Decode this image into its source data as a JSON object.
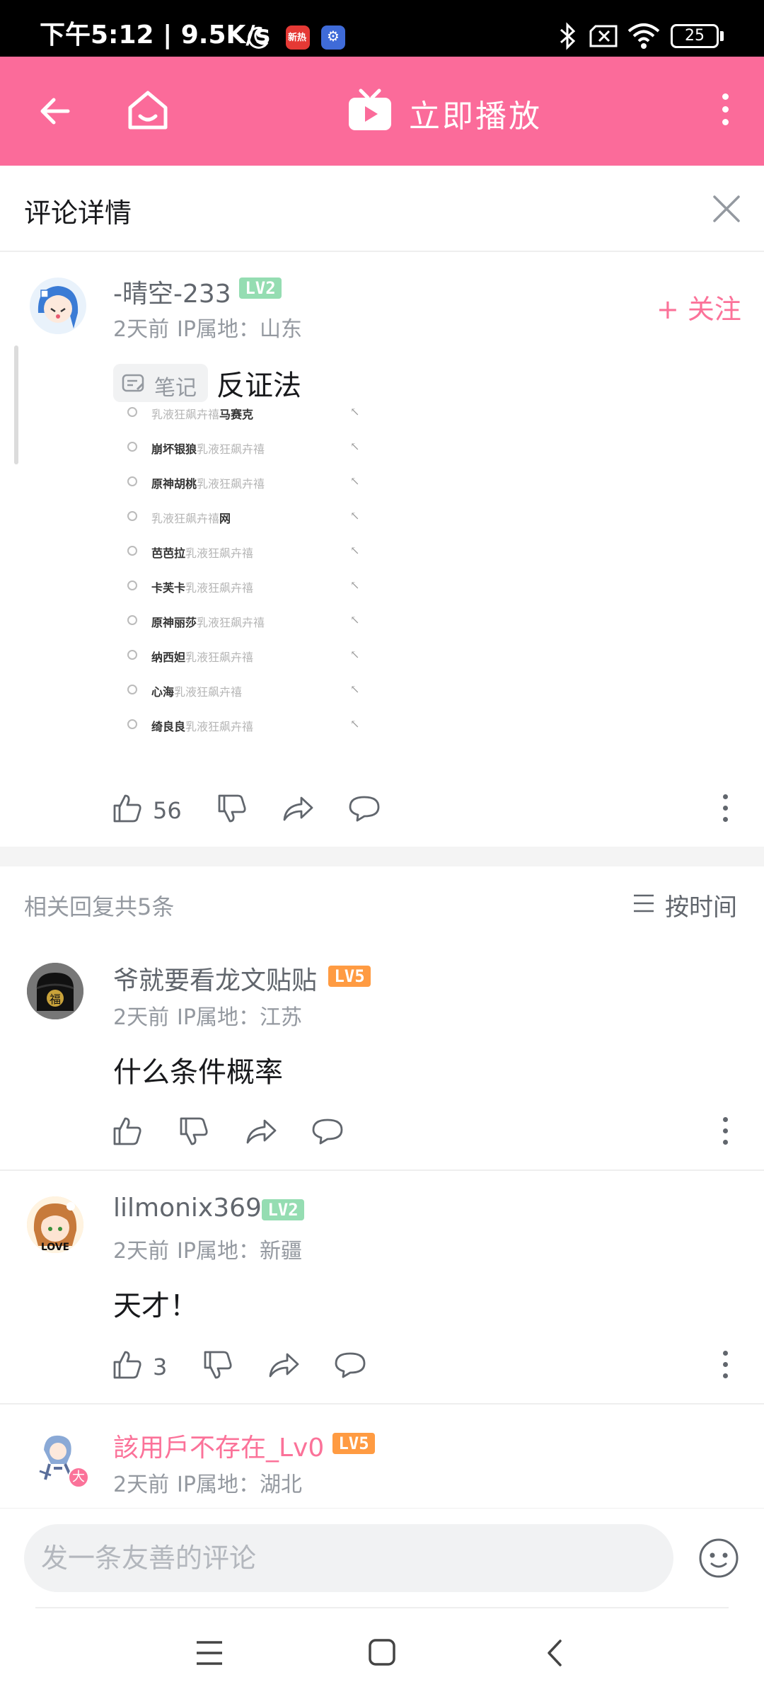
{
  "status_bar": {
    "time": "下午5:12 | 9.5K/s",
    "battery": "25",
    "app_badge_text": "新热",
    "colors": {
      "bg": "#000000",
      "fg": "#ffffff"
    }
  },
  "app_bar": {
    "title": "立即播放",
    "icons": [
      "back-arrow-icon",
      "home-icon",
      "tv-play-icon",
      "more-vertical-icon"
    ],
    "color": "#fb6b9a"
  },
  "panel": {
    "title": "评论详情",
    "close_icon": "close-icon"
  },
  "main_comment": {
    "username": "-晴空-233",
    "level": "LV2",
    "time": "2天前",
    "ip": "IP属地：山东",
    "follow_label": "+ 关注",
    "note_tag": "笔记",
    "text": "反证法",
    "like_count": "56",
    "image_suggestions": [
      {
        "hi": "",
        "lo": "乳液狂飙卉禧",
        "hi2": "马赛克"
      },
      {
        "hi": "崩坏银狼",
        "lo": "乳液狂飙卉禧",
        "hi2": ""
      },
      {
        "hi": "原神胡桃",
        "lo": "乳液狂飙卉禧",
        "hi2": ""
      },
      {
        "hi": "",
        "lo": "乳液狂飙卉禧",
        "hi2": "网"
      },
      {
        "hi": "芭芭拉",
        "lo": "乳液狂飙卉禧",
        "hi2": ""
      },
      {
        "hi": "卡芙卡",
        "lo": "乳液狂飙卉禧",
        "hi2": ""
      },
      {
        "hi": "原神丽莎",
        "lo": "乳液狂飙卉禧",
        "hi2": ""
      },
      {
        "hi": "纳西妲",
        "lo": "乳液狂飙卉禧",
        "hi2": ""
      },
      {
        "hi": "心海",
        "lo": "乳液狂飙卉禧",
        "hi2": ""
      },
      {
        "hi": "绮良良",
        "lo": "乳液狂飙卉禧",
        "hi2": ""
      }
    ]
  },
  "replies_header": {
    "count_text": "相关回复共5条",
    "sort_label": "按时间",
    "sort_icon": "list-sort-icon"
  },
  "replies": [
    {
      "username": "爷就要看龙文贴贴",
      "level": "LV5",
      "time": "2天前",
      "ip": "IP属地：江苏",
      "text": "什么条件概率",
      "like_count": ""
    },
    {
      "username": "lilmonix369",
      "level": "LV2",
      "time": "2天前",
      "ip": "IP属地：新疆",
      "text": "天才！",
      "like_count": "3"
    },
    {
      "username": "該用戶不存在_Lv0",
      "level": "LV5",
      "time": "2天前",
      "ip": "IP属地：湖北",
      "avatar_badge": "大"
    }
  ],
  "input": {
    "placeholder": "发一条友善的评论",
    "emoji_icon": "emoji-icon"
  },
  "nav_bar": {
    "icons": [
      "menu-icon",
      "home-square-icon",
      "back-chevron-icon"
    ]
  },
  "colors": {
    "pink": "#fb6b9a",
    "vip_name": "#fb7299",
    "lv2": "#95ddb2",
    "lv5": "#ff9b42",
    "text_main": "#18191c",
    "text_secondary": "#61666d",
    "text_meta": "#9499a0"
  }
}
